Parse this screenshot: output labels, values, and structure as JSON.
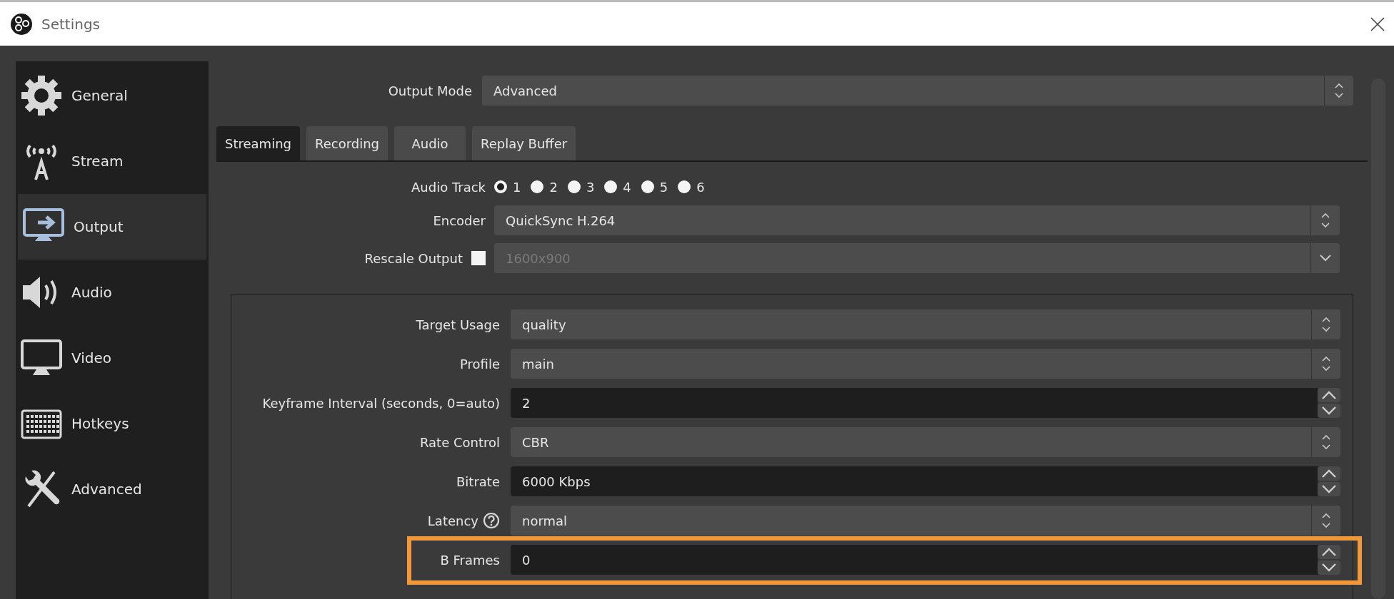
{
  "window": {
    "title": "Settings"
  },
  "sidebar": {
    "items": [
      {
        "label": "General",
        "kind": "gear",
        "selected": false
      },
      {
        "label": "Stream",
        "kind": "antenna",
        "selected": false
      },
      {
        "label": "Output",
        "kind": "output",
        "selected": true
      },
      {
        "label": "Audio",
        "kind": "speaker",
        "selected": false
      },
      {
        "label": "Video",
        "kind": "monitor",
        "selected": false
      },
      {
        "label": "Hotkeys",
        "kind": "keyboard",
        "selected": false
      },
      {
        "label": "Advanced",
        "kind": "tools",
        "selected": false
      }
    ]
  },
  "output_mode": {
    "label": "Output Mode",
    "value": "Advanced"
  },
  "tabs": [
    {
      "label": "Streaming",
      "selected": true
    },
    {
      "label": "Recording",
      "selected": false
    },
    {
      "label": "Audio",
      "selected": false
    },
    {
      "label": "Replay Buffer",
      "selected": false
    }
  ],
  "audio_track": {
    "label": "Audio Track",
    "options": [
      {
        "label": "1",
        "selected": true
      },
      {
        "label": "2",
        "selected": false
      },
      {
        "label": "3",
        "selected": false
      },
      {
        "label": "4",
        "selected": false
      },
      {
        "label": "5",
        "selected": false
      },
      {
        "label": "6",
        "selected": false
      }
    ]
  },
  "encoder": {
    "label": "Encoder",
    "value": "QuickSync H.264"
  },
  "rescale_output": {
    "label": "Rescale Output",
    "checked": false,
    "value": "1600x900",
    "disabled": true
  },
  "encoder_settings": [
    {
      "label": "Target Usage",
      "kind": "dropdown",
      "value": "quality",
      "help": false,
      "highlighted": false
    },
    {
      "label": "Profile",
      "kind": "dropdown",
      "value": "main",
      "help": false,
      "highlighted": false
    },
    {
      "label": "Keyframe Interval (seconds, 0=auto)",
      "kind": "spin",
      "value": "2",
      "help": false,
      "highlighted": false
    },
    {
      "label": "Rate Control",
      "kind": "dropdown",
      "value": "CBR",
      "help": false,
      "highlighted": false
    },
    {
      "label": "Bitrate",
      "kind": "spin",
      "value": "6000 Kbps",
      "help": false,
      "highlighted": false
    },
    {
      "label": "Latency",
      "kind": "dropdown",
      "value": "normal",
      "help": true,
      "highlighted": false
    },
    {
      "label": "B Frames",
      "kind": "spin",
      "value": "0",
      "help": false,
      "highlighted": true
    }
  ]
}
